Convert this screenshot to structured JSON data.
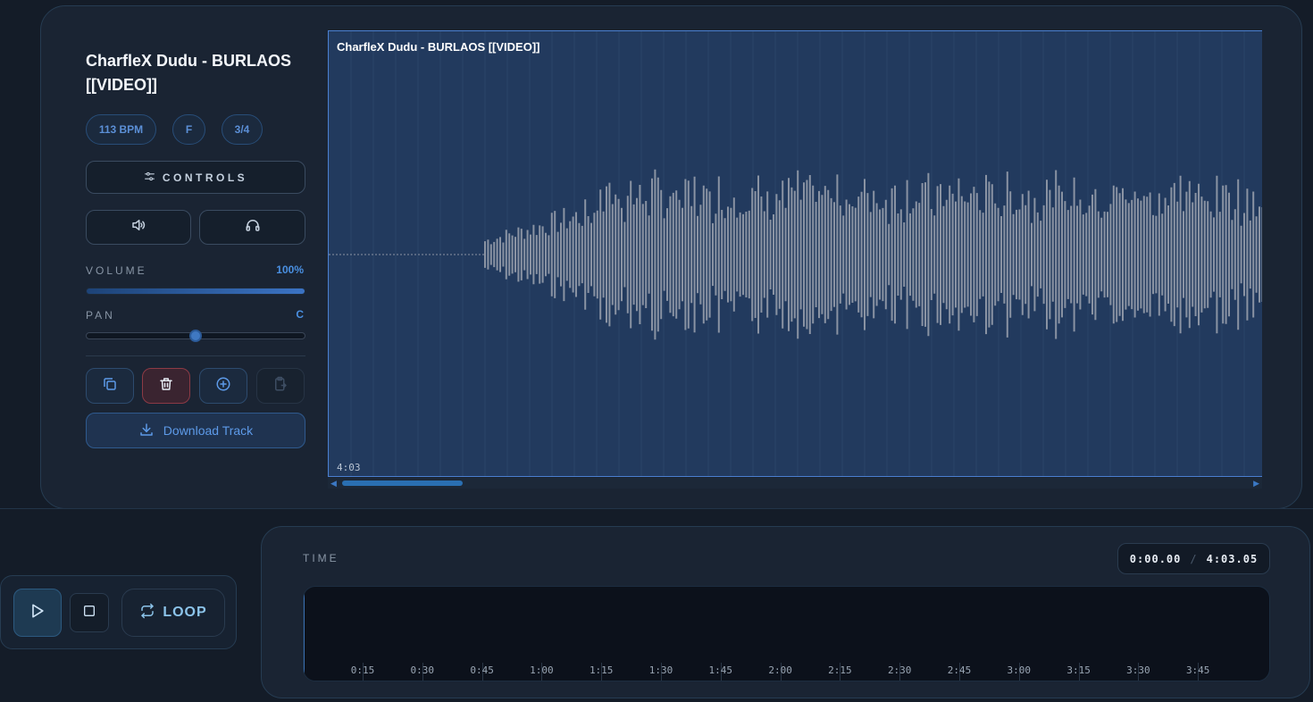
{
  "track": {
    "title": "CharfleX Dudu - BURLAOS [[VIDEO]]",
    "bpm": "113 BPM",
    "key": "F",
    "time_signature": "3/4",
    "controls_label": "CONTROLS",
    "volume_label": "VOLUME",
    "volume_value": "100%",
    "volume_fraction": 1.0,
    "pan_label": "PAN",
    "pan_value": "C",
    "pan_fraction": 0.5,
    "download_label": "Download Track"
  },
  "waveform": {
    "title": "CharfleX Dudu - BURLAOS [[VIDEO]]",
    "duration": "4:03",
    "color": "#8a93a3",
    "background": "#223a5e"
  },
  "transport": {
    "loop_label": "LOOP"
  },
  "time_panel": {
    "label": "TIME",
    "current": "0:00.00",
    "separator": "/",
    "total": "4:03.05",
    "ticks": [
      "0:15",
      "0:30",
      "0:45",
      "1:00",
      "1:15",
      "1:30",
      "1:45",
      "2:00",
      "2:15",
      "2:30",
      "2:45",
      "3:00",
      "3:15",
      "3:30",
      "3:45"
    ]
  },
  "icons": {
    "controls": "sliders-icon",
    "mute": "speaker-icon",
    "solo": "headphones-icon",
    "duplicate": "copy-icon",
    "delete": "trash-icon",
    "add": "plus-circle-icon",
    "paste": "clipboard-icon",
    "download": "download-icon",
    "play": "play-icon",
    "stop": "stop-icon",
    "loop": "repeat-icon"
  }
}
